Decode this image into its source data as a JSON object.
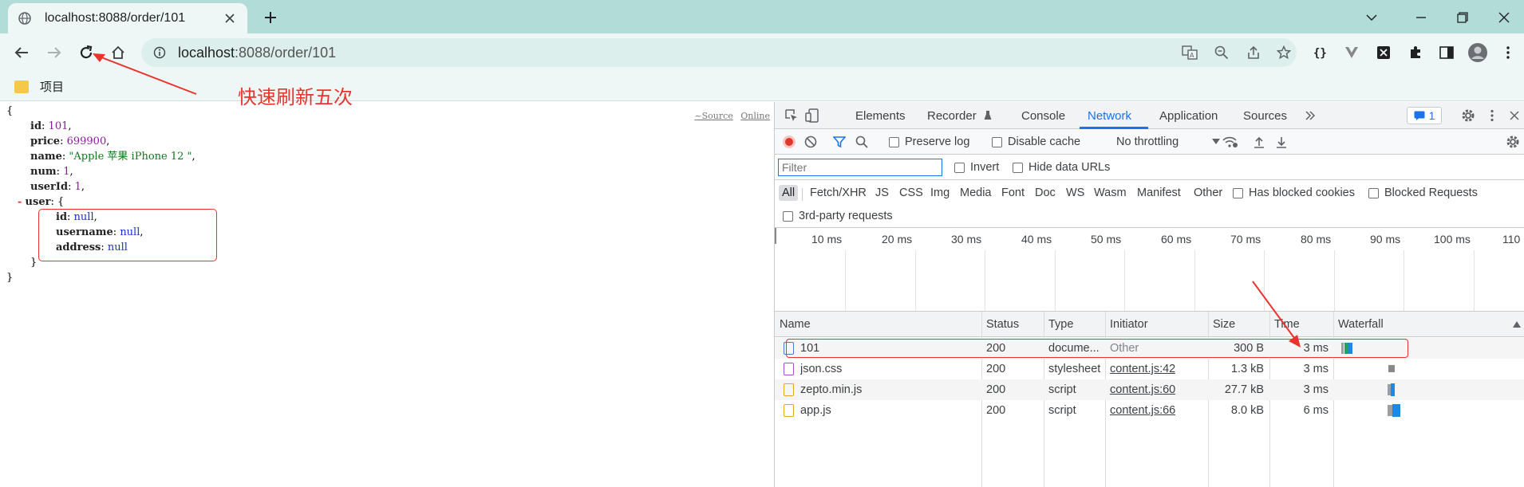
{
  "browser": {
    "tab_title": "localhost:8088/order/101",
    "url_host": "localhost",
    "url_rest": ":8088/order/101",
    "bookmark_label": "项目"
  },
  "annotation": {
    "text": "快速刷新五次",
    "color": "#e8342c"
  },
  "json_view": {
    "open_brace": "{",
    "close_brace": "}",
    "inner_open": "{",
    "inner_close": "}",
    "toggle": "-",
    "source_link": "~Source",
    "online_link": "Online",
    "fields": [
      {
        "key": "id",
        "value": "101",
        "kind": "num"
      },
      {
        "key": "price",
        "value": "699900",
        "kind": "num"
      },
      {
        "key": "name",
        "value": "\"Apple 苹果 iPhone 12 \"",
        "kind": "str"
      },
      {
        "key": "num",
        "value": "1",
        "kind": "num"
      },
      {
        "key": "userId",
        "value": "1",
        "kind": "num"
      }
    ],
    "user_key": "user",
    "user_fields": [
      {
        "key": "id",
        "value": "null"
      },
      {
        "key": "username",
        "value": "null"
      },
      {
        "key": "address",
        "value": "null"
      }
    ]
  },
  "devtools": {
    "tabs": [
      "Elements",
      "Recorder",
      "Console",
      "Network",
      "Application",
      "Sources"
    ],
    "active_tab": "Network",
    "issues_count": "1",
    "toolbar": {
      "preserve_log": "Preserve log",
      "disable_cache": "Disable cache",
      "throttling": "No throttling"
    },
    "filter_placeholder": "Filter",
    "invert": "Invert",
    "hide_data_urls": "Hide data URLs",
    "filter_types": [
      "All",
      "Fetch/XHR",
      "JS",
      "CSS",
      "Img",
      "Media",
      "Font",
      "Doc",
      "WS",
      "Wasm",
      "Manifest",
      "Other"
    ],
    "has_blocked_cookies": "Has blocked cookies",
    "blocked_requests": "Blocked Requests",
    "third_party": "3rd-party requests",
    "timeline_labels": [
      "10 ms",
      "20 ms",
      "30 ms",
      "40 ms",
      "50 ms",
      "60 ms",
      "70 ms",
      "80 ms",
      "90 ms",
      "100 ms",
      "110"
    ],
    "columns": [
      "Name",
      "Status",
      "Type",
      "Initiator",
      "Size",
      "Time",
      "Waterfall"
    ],
    "rows": [
      {
        "name": "101",
        "status": "200",
        "type": "docume...",
        "initiator": "Other",
        "size": "300 B",
        "time": "3 ms",
        "icon_color": "#4a7bd4"
      },
      {
        "name": "json.css",
        "status": "200",
        "type": "stylesheet",
        "initiator": "content.js:42",
        "size": "1.3 kB",
        "time": "3 ms",
        "icon_color": "#a34fd8"
      },
      {
        "name": "zepto.min.js",
        "status": "200",
        "type": "script",
        "initiator": "content.js:60",
        "size": "27.7 kB",
        "time": "3 ms",
        "icon_color": "#e6a817"
      },
      {
        "name": "app.js",
        "status": "200",
        "type": "script",
        "initiator": "content.js:66",
        "size": "8.0 kB",
        "time": "6 ms",
        "icon_color": "#e6a817"
      }
    ]
  }
}
